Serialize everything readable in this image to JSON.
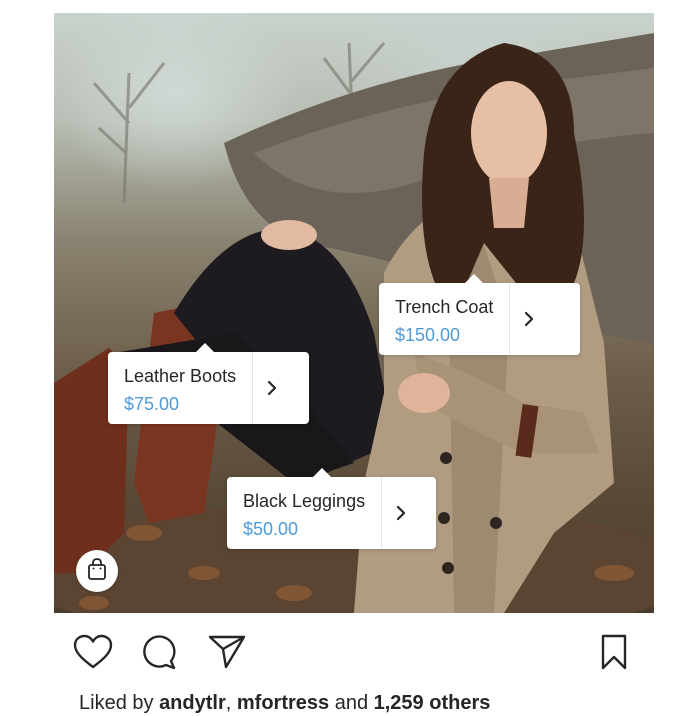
{
  "post": {
    "products": [
      {
        "name": "Trench Coat",
        "price": "$150.00"
      },
      {
        "name": "Leather Boots",
        "price": "$75.00"
      },
      {
        "name": "Black Leggings",
        "price": "$50.00"
      }
    ]
  },
  "likes": {
    "prefix": "Liked by ",
    "user1": "andytlr",
    "sep": ", ",
    "user2": "mfortress",
    "and": " and ",
    "others": "1,259 others"
  },
  "colors": {
    "price": "#4f9ad8",
    "text": "#262626"
  },
  "icons": {
    "like": "heart-icon",
    "comment": "comment-icon",
    "share": "paper-plane-icon",
    "save": "bookmark-icon",
    "shop": "shopping-bag-icon",
    "tag_arrow": "chevron-right-icon"
  }
}
